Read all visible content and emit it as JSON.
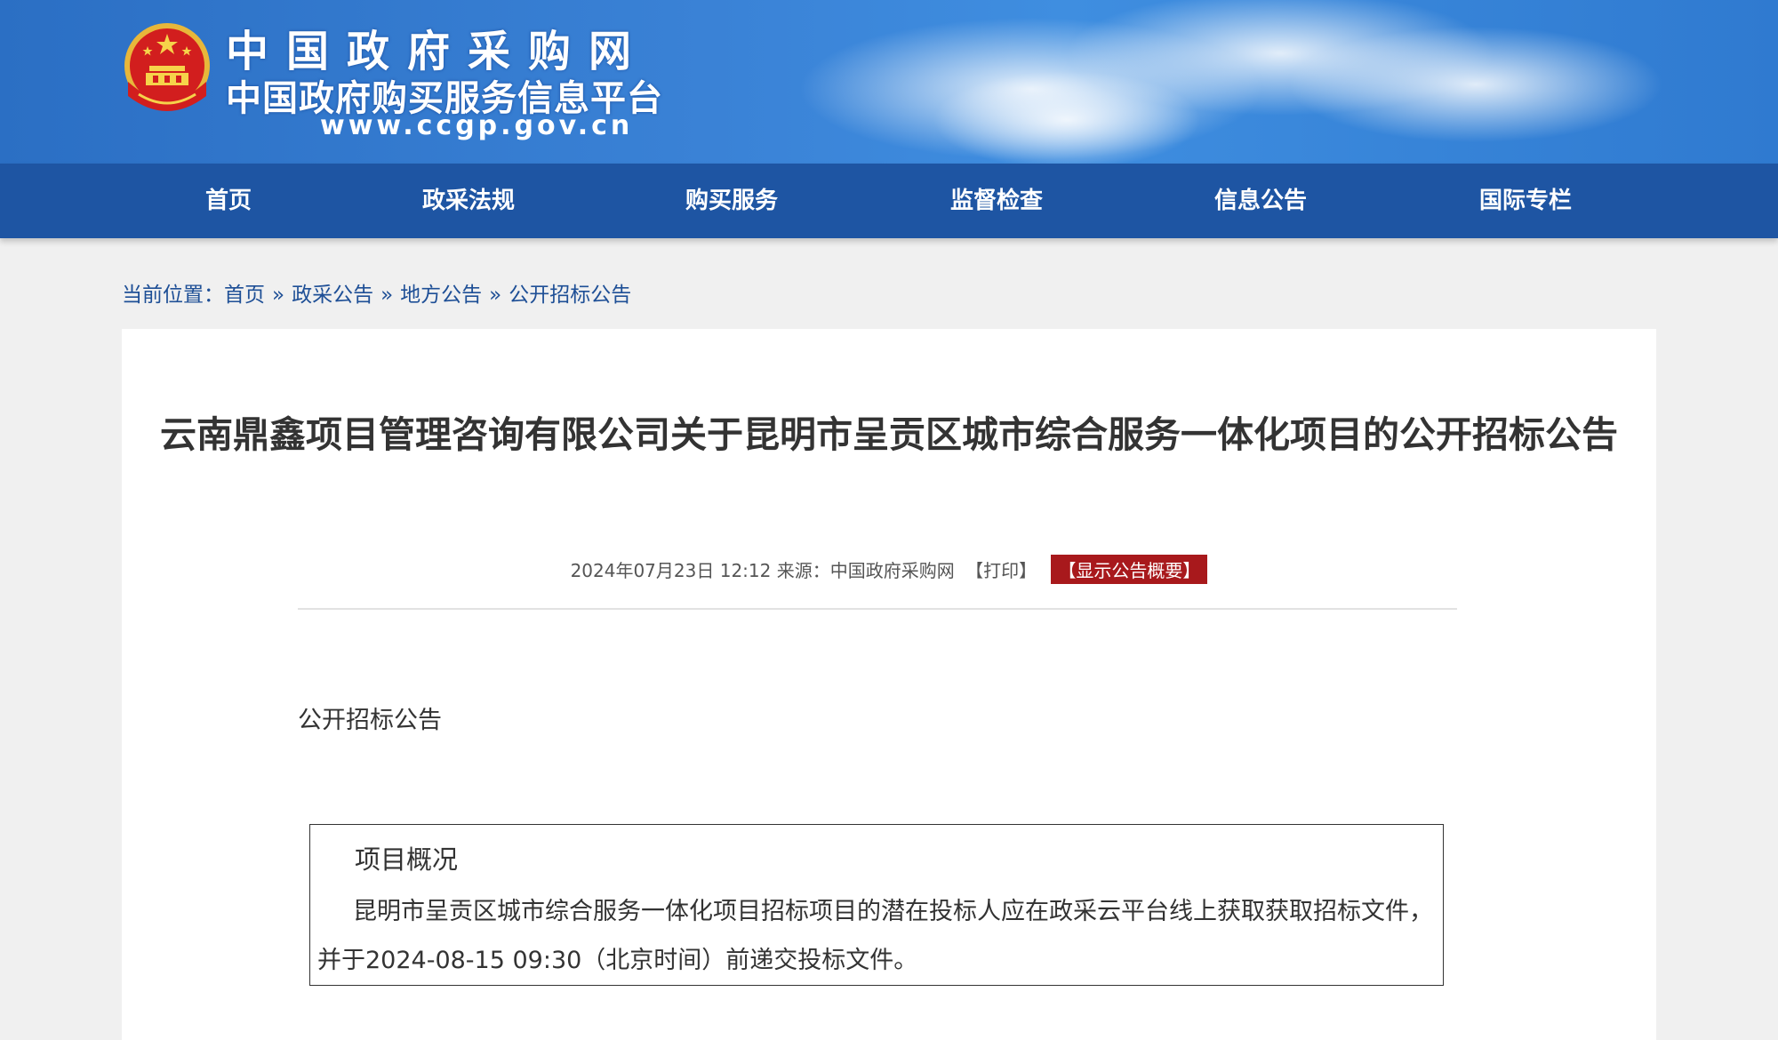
{
  "header": {
    "site_name": "中国政府采购网",
    "site_subtitle": "中国政府购买服务信息平台",
    "site_url": "www.ccgp.gov.cn",
    "banner_color": "#3a82d6"
  },
  "nav": {
    "color": "#1e55a3",
    "items": [
      {
        "label": "首页"
      },
      {
        "label": "政采法规"
      },
      {
        "label": "购买服务"
      },
      {
        "label": "监督检查"
      },
      {
        "label": "信息公告"
      },
      {
        "label": "国际专栏"
      }
    ]
  },
  "breadcrumb": {
    "prefix": "当前位置：",
    "items": [
      "首页",
      "政采公告",
      "地方公告",
      "公开招标公告"
    ],
    "separator": "»"
  },
  "article": {
    "title": "云南鼎鑫项目管理咨询有限公司关于昆明市呈贡区城市综合服务一体化项目的公开招标公告",
    "datetime": "2024年07月23日 12:12",
    "source_label": "来源：",
    "source": "中国政府采购网",
    "print_label": "【打印】",
    "summary_button": "【显示公告概要】",
    "summary_button_color": "#a8191c",
    "section_title": "公开招标公告",
    "overview": {
      "heading": "项目概况",
      "text": "昆明市呈贡区城市综合服务一体化项目招标项目的潜在投标人应在政采云平台线上获取获取招标文件，并于2024-08-15 09:30（北京时间）前递交投标文件。"
    }
  }
}
